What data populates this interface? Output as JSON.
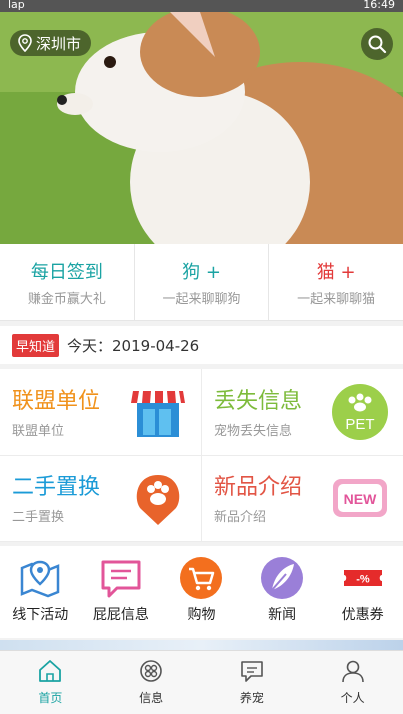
{
  "status": {
    "left": "lap",
    "time": "16:49"
  },
  "header": {
    "city": "深圳市"
  },
  "quick": [
    {
      "title": "每日签到",
      "subtitle": "赚金币赢大礼",
      "color": "#1aa3a3"
    },
    {
      "title": "狗 +",
      "subtitle": "一起来聊聊狗",
      "color": "#1aa3a3"
    },
    {
      "title": "猫 +",
      "subtitle": "一起来聊聊猫",
      "color": "#e23a3a"
    }
  ],
  "news": {
    "tag": "早知道",
    "text": "今天：2019-04-26"
  },
  "grid": [
    {
      "title": "联盟单位",
      "subtitle": "联盟单位",
      "color": "#f0921c",
      "icon": "shop-icon"
    },
    {
      "title": "丢失信息",
      "subtitle": "宠物丢失信息",
      "color": "#7dbb3b",
      "icon": "pet-icon",
      "badge": "PET"
    },
    {
      "title": "二手置换",
      "subtitle": "二手置换",
      "color": "#1b9bd7",
      "icon": "paw-pin-icon"
    },
    {
      "title": "新品介绍",
      "subtitle": "新品介绍",
      "color": "#e25545",
      "icon": "new-icon",
      "badge": "NEW"
    }
  ],
  "icons": [
    {
      "label": "线下活动",
      "icon": "map-icon"
    },
    {
      "label": "屁屁信息",
      "icon": "message-icon"
    },
    {
      "label": "购物",
      "icon": "cart-icon"
    },
    {
      "label": "新闻",
      "icon": "feather-icon"
    },
    {
      "label": "优惠券",
      "icon": "coupon-icon",
      "text": "-%"
    }
  ],
  "tabs": [
    {
      "label": "首页",
      "active": true
    },
    {
      "label": "信息",
      "active": false
    },
    {
      "label": "养宠",
      "active": false
    },
    {
      "label": "个人",
      "active": false
    }
  ]
}
